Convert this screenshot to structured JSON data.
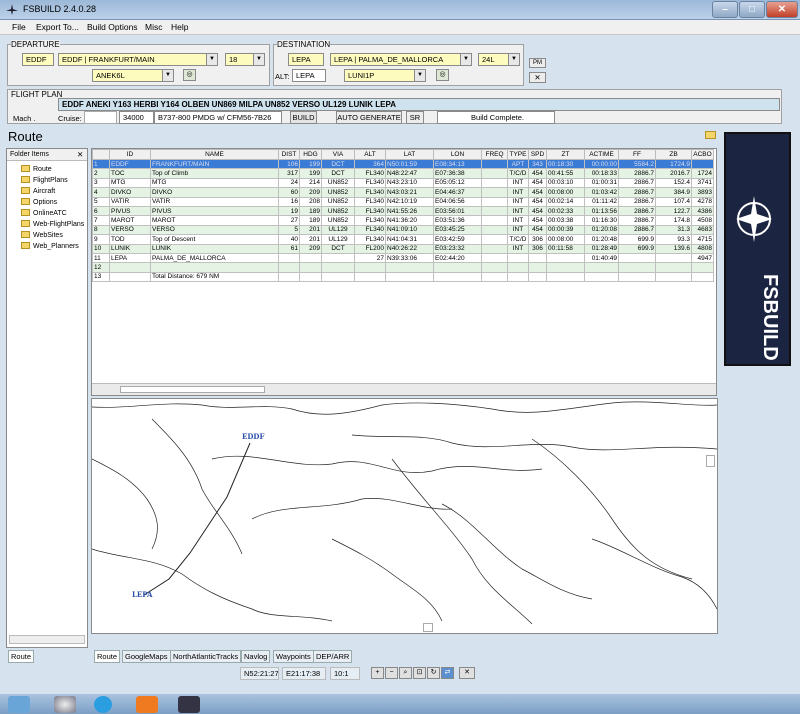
{
  "window": {
    "title": "FSBUILD 2.4.0.28",
    "min": "–",
    "max": "□",
    "close": "✕"
  },
  "menu": [
    "File",
    "Export To...",
    "Build Options",
    "Misc",
    "Help"
  ],
  "departure": {
    "label": "DEPARTURE",
    "icao": "EDDF",
    "airport": "EDDF | FRANKFURT/MAIN",
    "runway": "18",
    "sid": "ANEK6L"
  },
  "destination": {
    "label": "DESTINATION",
    "icao": "LEPA",
    "airport": "LEPA | PALMA_DE_MALLORCA",
    "runway": "24L",
    "alt_label": "ALT:",
    "alt": "LEPA",
    "star": "LUNI1P"
  },
  "pm_label": "PM",
  "flightplan": {
    "label": "FLIGHT PLAN",
    "route": "EDDF ANEKI Y163 HERBI Y164 OLBEN UN869 MILPA UN852 VERSO UL129 LUNIK LEPA",
    "mach_label": "Mach .",
    "cruise_label": "Cruise:",
    "cruise": "34000",
    "aircraft": "B737-800 PMDG w/ CFM56-7B26",
    "build": "BUILD",
    "autogen": "AUTO GENERATE",
    "sr": "SR",
    "status": "Build Complete."
  },
  "route_title": "Route",
  "folder": {
    "header": "Folder Items",
    "close": "✕",
    "items": [
      "Route",
      "FlightPlans",
      "Aircraft",
      "Options",
      "OnlineATC",
      "Web-FlightPlans",
      "WebSites",
      "Web_Planners"
    ]
  },
  "table": {
    "headers": [
      "",
      "ID",
      "NAME",
      "DIST",
      "HDG",
      "VIA",
      "ALT",
      "LAT",
      "LON",
      "FREQ",
      "TYPE",
      "SPD",
      "ZT",
      "ACTIME",
      "FF",
      "ZB",
      "ACBO"
    ],
    "rows": [
      [
        "1",
        "EDDF",
        "FRANKFURT/MAIN",
        "106",
        "199",
        "DCT",
        "364",
        "N50:01:59",
        "E08:34:13",
        "",
        "APT",
        "343",
        "00:18:30",
        "00:00:00",
        "5584.2",
        "1724.9",
        ""
      ],
      [
        "2",
        "TOC",
        "Top of Climb",
        "317",
        "199",
        "DCT",
        "FL340",
        "N48:22:47",
        "E07:36:38",
        "",
        "T/C/D",
        "454",
        "00:41:55",
        "00:18:33",
        "2886.7",
        "2016.7",
        "1724"
      ],
      [
        "3",
        "MTG",
        "MTG",
        "24",
        "214",
        "UN852",
        "FL340",
        "N43:23:10",
        "E05:05:12",
        "",
        "INT",
        "454",
        "00:03:10",
        "01:00:31",
        "2886.7",
        "152.4",
        "3741"
      ],
      [
        "4",
        "DIVKO",
        "DIVKO",
        "60",
        "209",
        "UN852",
        "FL340",
        "N43:03:21",
        "E04:46:37",
        "",
        "INT",
        "454",
        "00:08:00",
        "01:03:42",
        "2886.7",
        "384.9",
        "3893"
      ],
      [
        "5",
        "VATIR",
        "VATIR",
        "16",
        "208",
        "UN852",
        "FL340",
        "N42:10:19",
        "E04:06:56",
        "",
        "INT",
        "454",
        "00:02:14",
        "01:11:42",
        "2886.7",
        "107.4",
        "4278"
      ],
      [
        "6",
        "PIVUS",
        "PIVUS",
        "19",
        "189",
        "UN852",
        "FL340",
        "N41:55:26",
        "E03:56:01",
        "",
        "INT",
        "454",
        "00:02:33",
        "01:13:56",
        "2886.7",
        "122.7",
        "4386"
      ],
      [
        "7",
        "MAROT",
        "MAROT",
        "27",
        "189",
        "UN852",
        "FL340",
        "N41:36:20",
        "E03:51:36",
        "",
        "INT",
        "454",
        "00:03:38",
        "01:16:30",
        "2886.7",
        "174.8",
        "4508"
      ],
      [
        "8",
        "VERSO",
        "VERSO",
        "5",
        "201",
        "UL129",
        "FL340",
        "N41:09:10",
        "E03:45:25",
        "",
        "INT",
        "454",
        "00:00:39",
        "01:20:08",
        "2886.7",
        "31.3",
        "4683"
      ],
      [
        "9",
        "TOD",
        "Top of Descent",
        "40",
        "201",
        "UL129",
        "FL340",
        "N41:04:31",
        "E03:42:59",
        "",
        "T/C/D",
        "306",
        "00:08:00",
        "01:20:48",
        "699.9",
        "93.3",
        "4715"
      ],
      [
        "10",
        "LUNIK",
        "LUNIK",
        "61",
        "209",
        "DCT",
        "FL200",
        "N40:26:22",
        "E03:23:32",
        "",
        "INT",
        "306",
        "00:11:58",
        "01:28:49",
        "699.9",
        "139.6",
        "4808"
      ],
      [
        "11",
        "LEPA",
        "PALMA_DE_MALLORCA",
        "",
        "",
        "",
        "27",
        "N39:33:06",
        "E02:44:20",
        "",
        "",
        "",
        "",
        "01:40:49",
        "",
        "",
        "4947"
      ],
      [
        "12",
        "",
        "",
        "",
        "",
        "",
        "",
        "",
        "",
        "",
        "",
        "",
        "",
        "",
        "",
        "",
        ""
      ],
      [
        "13",
        "",
        "Total Distance: 679 NM",
        "",
        "",
        "",
        "",
        "",
        "",
        "",
        "",
        "",
        "",
        "",
        "",
        "",
        ""
      ]
    ]
  },
  "logo_text": "FSBUILD",
  "map_labels": {
    "start": "EDDF",
    "end": "LEPA"
  },
  "bottom_tabs": [
    "Route",
    "GoogleMaps",
    "NorthAtlanticTracks",
    "Navlog",
    "Waypoints",
    "DEP/ARR"
  ],
  "left_tab": "Route",
  "status": {
    "lat": "N52:21:27",
    "lon": "E21:17:38",
    "zoom": "10:1"
  }
}
